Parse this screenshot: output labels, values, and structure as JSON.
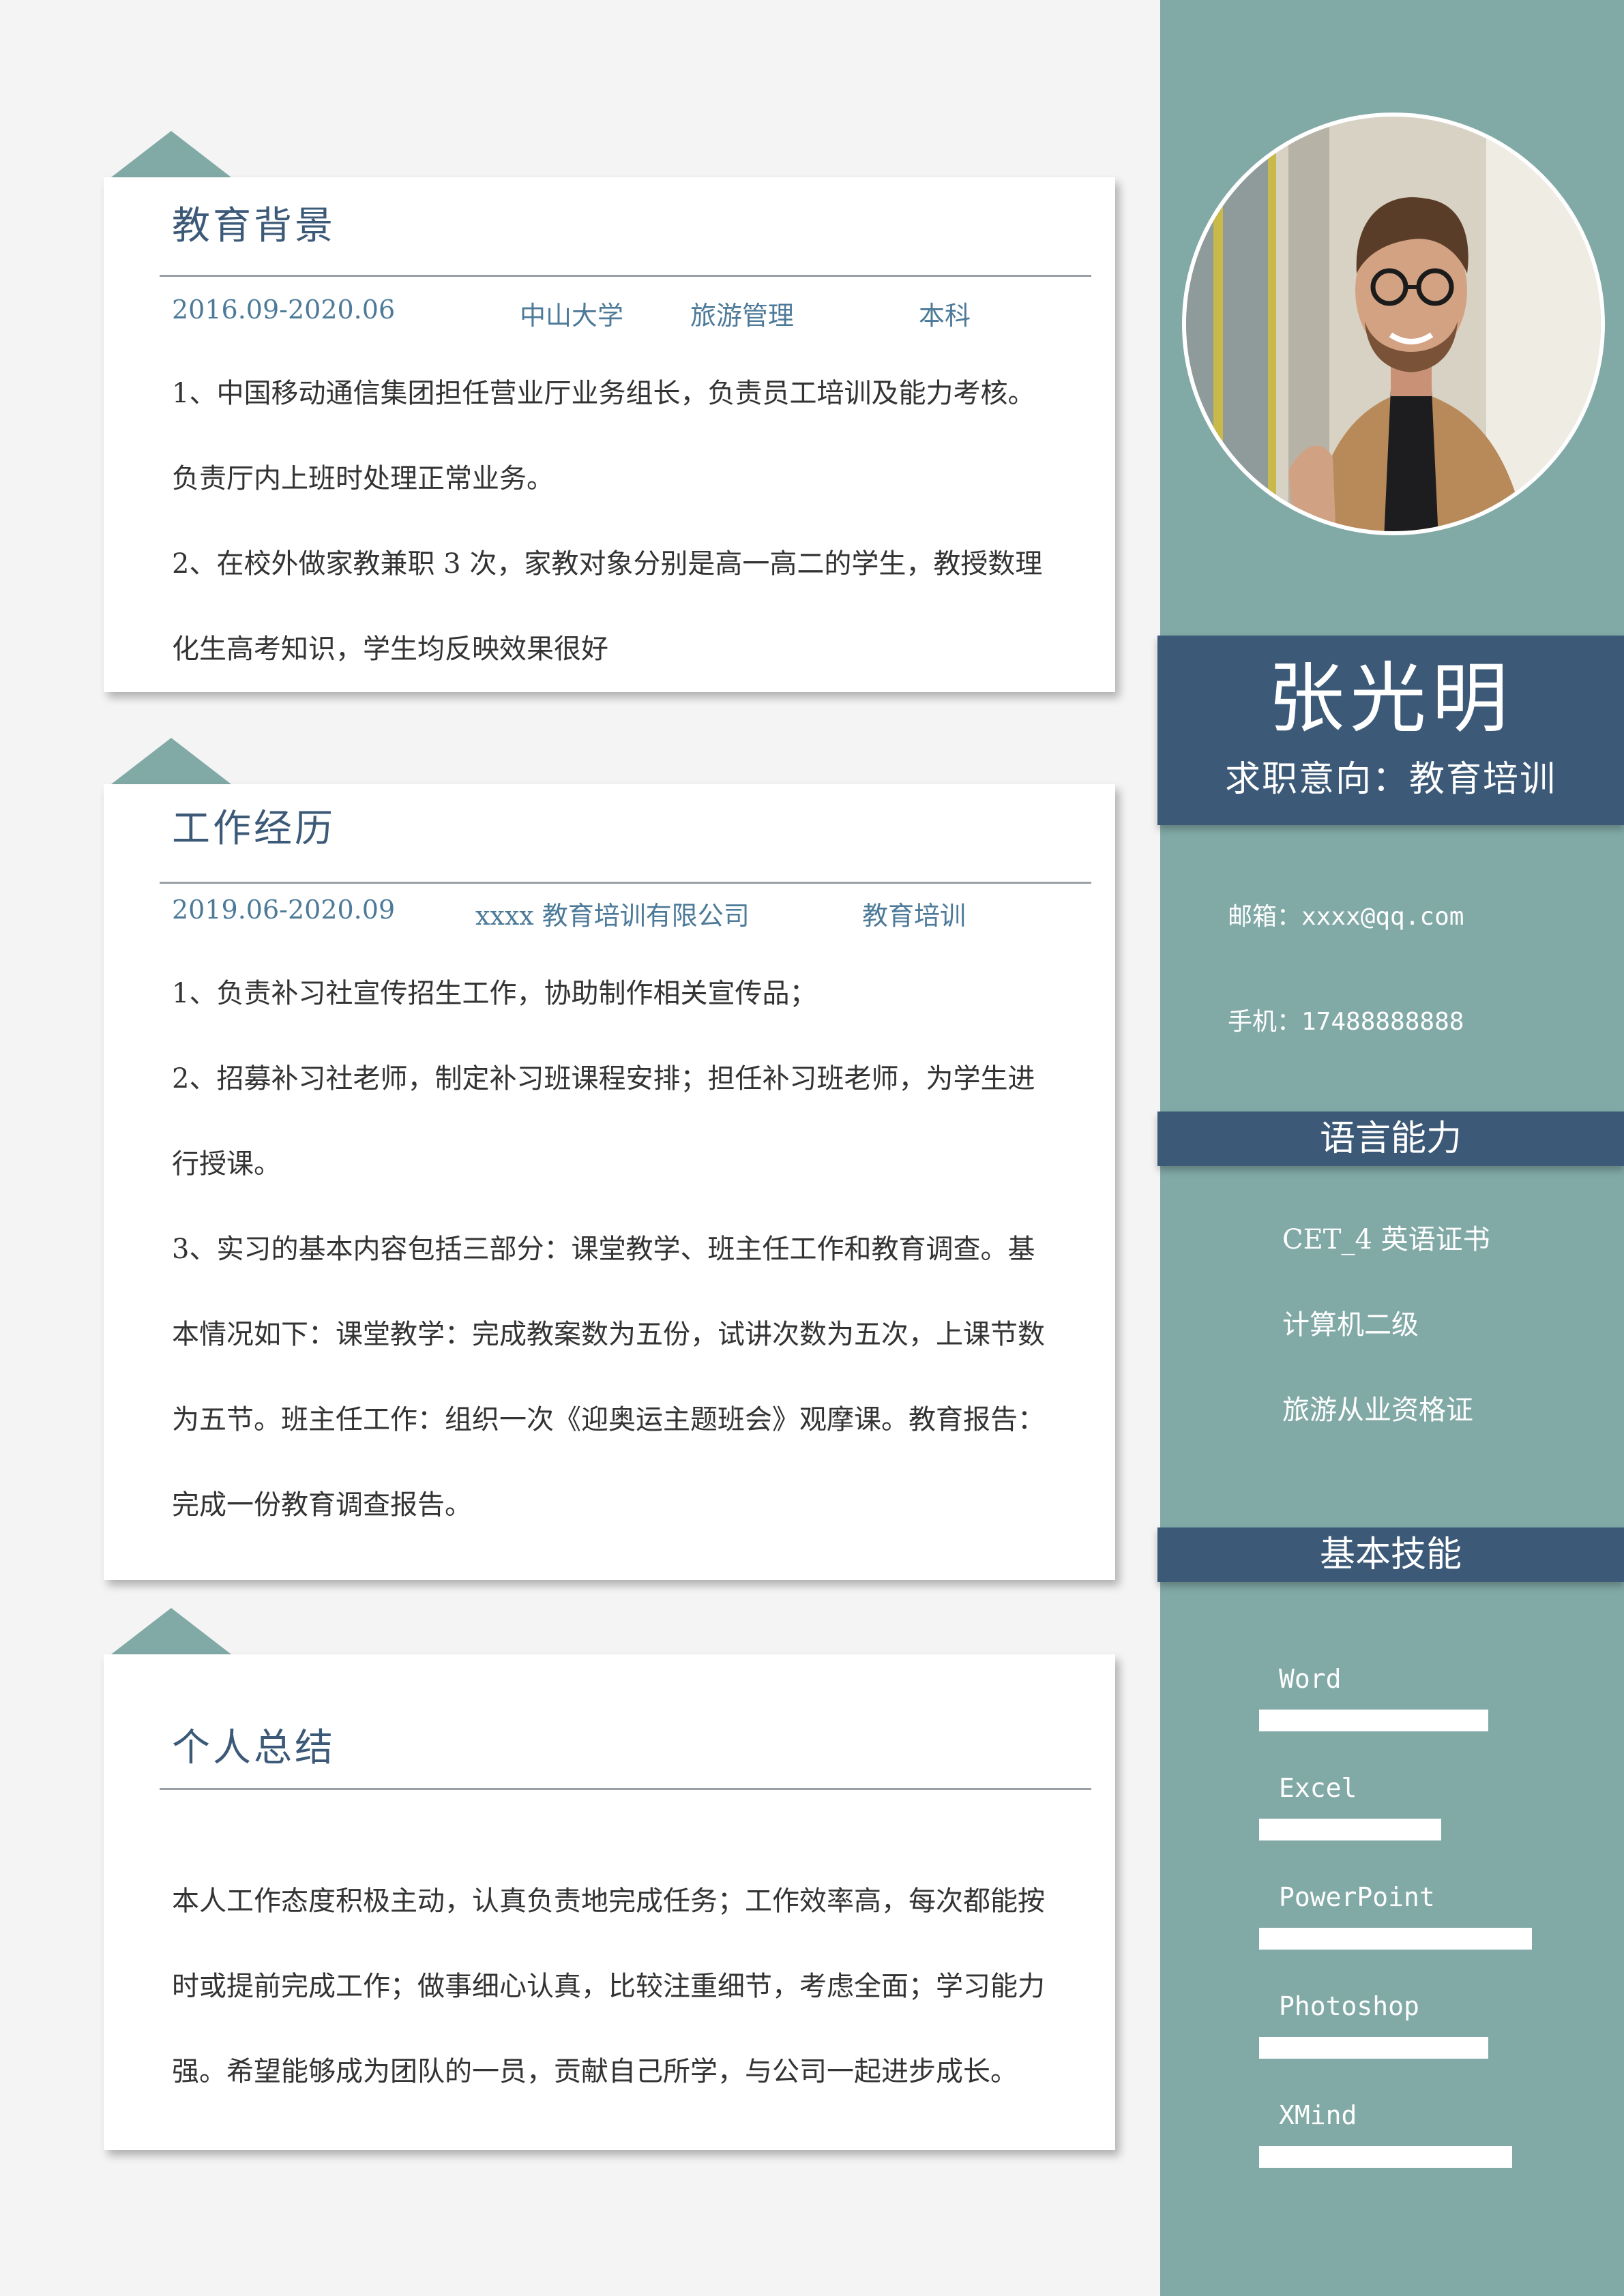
{
  "profile": {
    "name": "张光明",
    "objective": "求职意向：教育培训",
    "email": "邮箱：xxxx@qq.com",
    "phone": "手机：17488888888",
    "photo_icon": "portrait-photo"
  },
  "language": {
    "title": "语言能力",
    "items": [
      "CET_4 英语证书",
      "计算机二级",
      "旅游从业资格证"
    ]
  },
  "skills": {
    "title": "基本技能",
    "items": [
      {
        "name": "Word",
        "level": 0.58
      },
      {
        "name": "Excel",
        "level": 0.46
      },
      {
        "name": "PowerPoint",
        "level": 0.69
      },
      {
        "name": "Photoshop",
        "level": 0.58
      },
      {
        "name": "XMind",
        "level": 0.64
      }
    ]
  },
  "education": {
    "title": "教育背景",
    "period": "2016.09-2020.06",
    "school": "中山大学",
    "major": "旅游管理",
    "degree": "本科",
    "lines": [
      "1、中国移动通信集团担任营业厅业务组长，负责员工培训及能力考核。",
      "负责厅内上班时处理正常业务。",
      "2、在校外做家教兼职 3 次，家教对象分别是高一高二的学生，教授数理",
      "化生高考知识，学生均反映效果很好"
    ]
  },
  "work": {
    "title": "工作经历",
    "period": "2019.06-2020.09",
    "company": "xxxx 教育培训有限公司",
    "position": "教育培训",
    "lines": [
      "1、负责补习社宣传招生工作，协助制作相关宣传品；",
      "2、招募补习社老师，制定补习班课程安排；担任补习班老师，为学生进",
      "行授课。",
      "3、实习的基本内容包括三部分：课堂教学、班主任工作和教育调查。基",
      "本情况如下：课堂教学：完成教案数为五份，试讲次数为五次，上课节数",
      "为五节。班主任工作：组织一次《迎奥运主题班会》观摩课。教育报告：",
      "完成一份教育调查报告。"
    ]
  },
  "summary": {
    "title": "个人总结",
    "lines": [
      "本人工作态度积极主动，认真负责地完成任务；工作效率高，每次都能按",
      "时或提前完成工作；做事细心认真，比较注重细节，考虑全面；学习能力",
      "强。希望能够成为团队的一员，贡献自己所学，与公司一起进步成长。"
    ]
  },
  "colors": {
    "accent": "#81a9a6",
    "navy": "#3c5a78",
    "meta_text": "#4d7a99",
    "background": "#f4f4f4"
  }
}
